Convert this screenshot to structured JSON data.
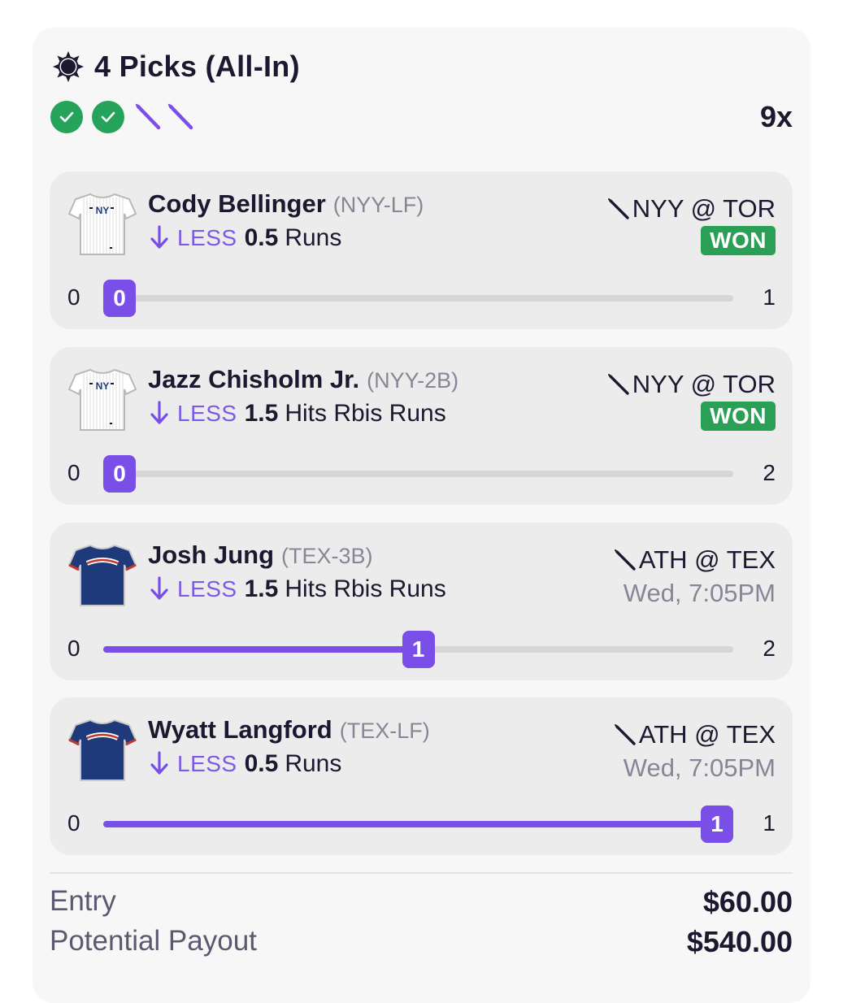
{
  "header": {
    "title": "4 Picks (All-In)",
    "multiplier": "9x",
    "status_icons": [
      "check-icon",
      "check-icon",
      "bat-icon",
      "bat-icon"
    ]
  },
  "picks": [
    {
      "player": "Cody Bellinger",
      "team_pos": "(NYY-LF)",
      "direction": "LESS",
      "line": "0.5",
      "stat": "Runs",
      "matchup": "NYY @ TOR",
      "status": "WON",
      "time": "",
      "jersey": "pinstripe",
      "min": "0",
      "max": "1",
      "current": "0",
      "progress": 0
    },
    {
      "player": "Jazz Chisholm Jr.",
      "team_pos": "(NYY-2B)",
      "direction": "LESS",
      "line": "1.5",
      "stat": "Hits Rbis Runs",
      "matchup": "NYY @ TOR",
      "status": "WON",
      "time": "",
      "jersey": "pinstripe",
      "min": "0",
      "max": "2",
      "current": "0",
      "progress": 0
    },
    {
      "player": "Josh Jung",
      "team_pos": "(TEX-3B)",
      "direction": "LESS",
      "line": "1.5",
      "stat": "Hits Rbis Runs",
      "matchup": "ATH @ TEX",
      "status": "",
      "time": "Wed, 7:05PM",
      "jersey": "navy",
      "min": "0",
      "max": "2",
      "current": "1",
      "progress": 0.5
    },
    {
      "player": "Wyatt Langford",
      "team_pos": "(TEX-LF)",
      "direction": "LESS",
      "line": "0.5",
      "stat": "Runs",
      "matchup": "ATH @ TEX",
      "status": "",
      "time": "Wed, 7:05PM",
      "jersey": "navy",
      "min": "0",
      "max": "1",
      "current": "1",
      "progress": 1
    }
  ],
  "summary": {
    "entry_label": "Entry",
    "entry_value": "$60.00",
    "payout_label": "Potential Payout",
    "payout_value": "$540.00"
  },
  "colors": {
    "accent": "#7a4fe8",
    "won": "#2a9f56",
    "navy": "#1f3a7a"
  }
}
